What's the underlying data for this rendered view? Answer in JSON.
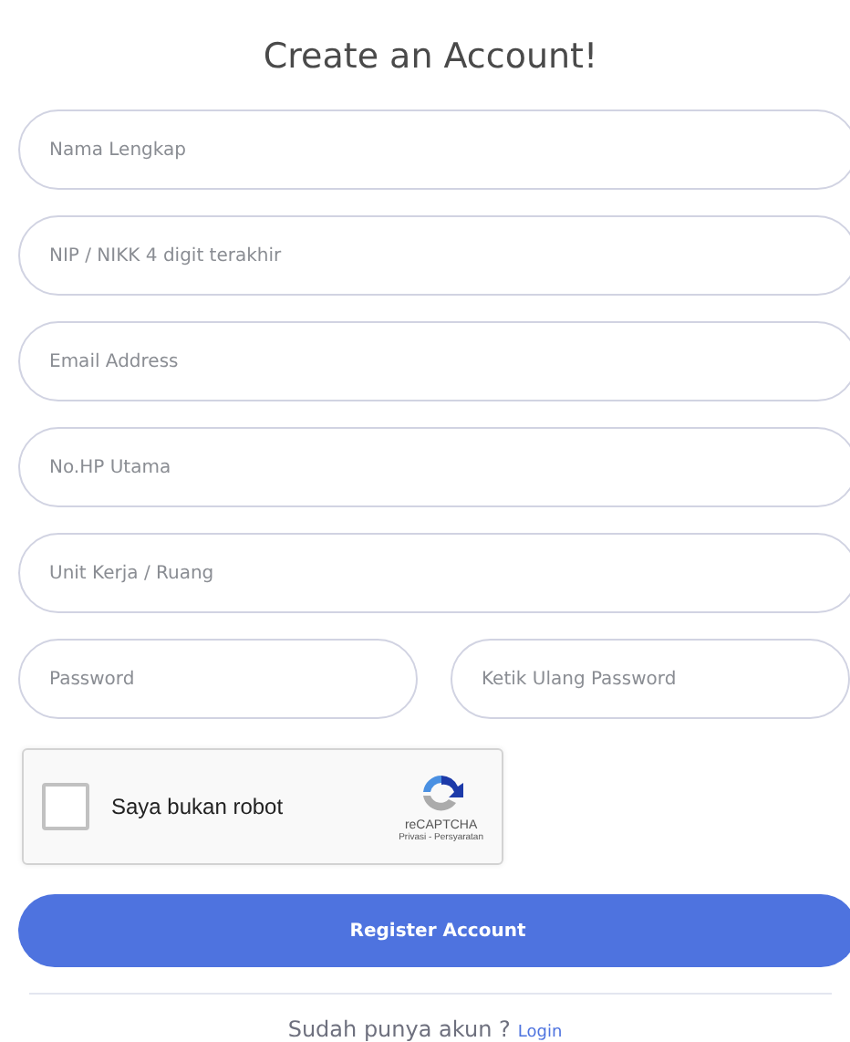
{
  "title": "Create an Account!",
  "fields": [
    {
      "placeholder": "Nama Lengkap"
    },
    {
      "placeholder": "NIP / NIKK 4 digit terakhir"
    },
    {
      "placeholder": "Email Address"
    },
    {
      "placeholder": "No.HP Utama"
    },
    {
      "placeholder": "Unit Kerja / Ruang"
    }
  ],
  "password_fields": [
    {
      "placeholder": "Password"
    },
    {
      "placeholder": "Ketik Ulang Password"
    }
  ],
  "captcha": {
    "label": "Saya bukan robot",
    "checked": false,
    "brand": "reCAPTCHA",
    "links": "Privasi - Persyaratan"
  },
  "submit": "Register Account",
  "footer": {
    "text": "Sudah punya akun ?",
    "link": "Login"
  }
}
